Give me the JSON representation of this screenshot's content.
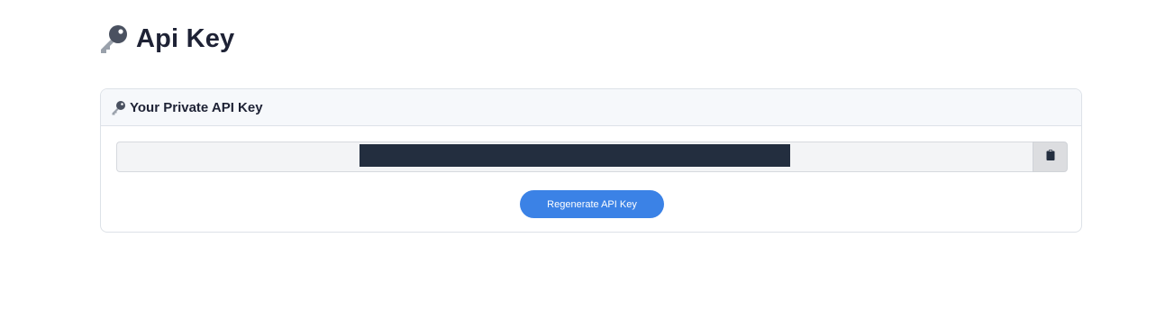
{
  "page": {
    "title": "Api Key"
  },
  "card": {
    "title": "Your Private API Key",
    "key_field_value": "",
    "regenerate_label": "Regenerate API Key"
  },
  "icons": {
    "header_icon": "key-icon",
    "card_icon": "key-icon",
    "copy_icon": "clipboard-icon"
  },
  "colors": {
    "primary_button": "#3b82e6",
    "title_text": "#1e2235",
    "key_mask": "#232e3f"
  }
}
